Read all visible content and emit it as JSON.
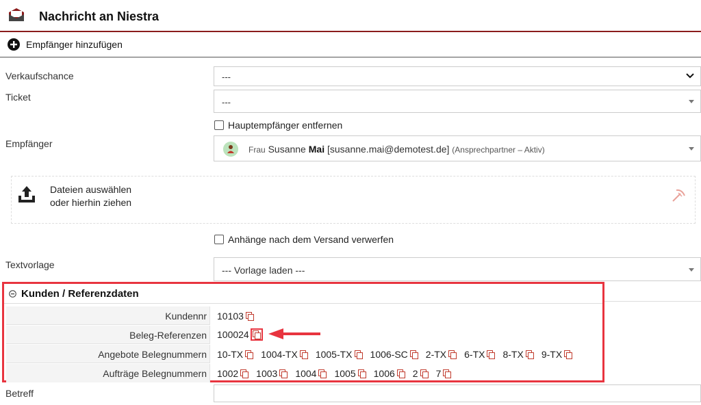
{
  "header": {
    "title": "Nachricht an Niestra"
  },
  "add_recipient": {
    "label": "Empfänger hinzufügen"
  },
  "form": {
    "verkaufschance": {
      "label": "Verkaufschance",
      "value": "---"
    },
    "ticket": {
      "label": "Ticket",
      "value": "---"
    },
    "hauptempfaenger": {
      "label": "Hauptempfänger entfernen",
      "checked": false
    },
    "empfaenger": {
      "label": "Empfänger",
      "salutation": "Frau",
      "first_name": "Susanne",
      "last_name": "Mai",
      "email": "[susanne.mai@demotest.de]",
      "role": "(Ansprechpartner – Aktiv)"
    },
    "dropzone": {
      "line1": "Dateien auswählen",
      "line2": "oder hierhin ziehen"
    },
    "anhaenge": {
      "label": "Anhänge nach dem Versand verwerfen",
      "checked": false
    },
    "textvorlage": {
      "label": "Textvorlage",
      "value": "--- Vorlage laden ---"
    },
    "betreff": {
      "label": "Betreff",
      "value": ""
    }
  },
  "referenzdaten": {
    "title": "Kunden / Referenzdaten",
    "rows": [
      {
        "label": "Kundennr",
        "items": [
          "10103"
        ]
      },
      {
        "label": "Beleg-Referenzen",
        "items": [
          "100024"
        ]
      },
      {
        "label": "Angebote Belegnummern",
        "items": [
          "10-TX",
          "1004-TX",
          "1005-TX",
          "1006-SC",
          "2-TX",
          "6-TX",
          "8-TX",
          "9-TX"
        ]
      },
      {
        "label": "Aufträge Belegnummern",
        "items": [
          "1002",
          "1003",
          "1004",
          "1005",
          "1006",
          "2",
          "7"
        ]
      }
    ]
  },
  "colors": {
    "accent": "#8b1c1c",
    "highlight": "#e8343f",
    "copy_icon": "#c0392b"
  }
}
